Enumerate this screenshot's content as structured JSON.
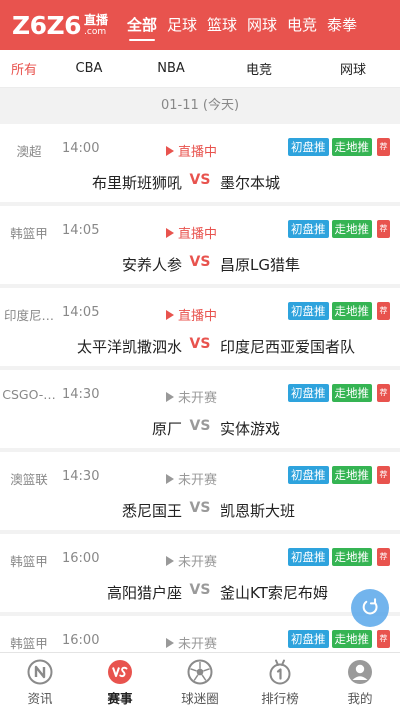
{
  "header": {
    "logo_main": "Z6Z6",
    "logo_cn": "直播",
    "logo_com": ".com",
    "tabs": [
      {
        "label": "全部"
      },
      {
        "label": "足球"
      },
      {
        "label": "篮球"
      },
      {
        "label": "网球"
      },
      {
        "label": "电竞"
      },
      {
        "label": "泰拳"
      }
    ],
    "active_tab": "全部"
  },
  "filter": {
    "items": [
      {
        "label": "所有"
      },
      {
        "label": "CBA"
      },
      {
        "label": "NBA"
      },
      {
        "label": "电竞"
      },
      {
        "label": "网球"
      }
    ],
    "active": "所有"
  },
  "date_label": "01-11 (今天)",
  "matches": [
    {
      "league": "澳超",
      "time": "14:00",
      "status": "直播中",
      "home": "布里斯班狮吼",
      "vs": "VS",
      "away": "墨尔本城"
    },
    {
      "league": "韩篮甲",
      "time": "14:05",
      "status": "直播中",
      "home": "安养人参",
      "vs": "VS",
      "away": "昌原LG猎隼"
    },
    {
      "league": "印度尼…",
      "time": "14:05",
      "status": "直播中",
      "home": "太平洋凯撒泗水",
      "vs": "VS",
      "away": "印度尼西亚爱国者队"
    },
    {
      "league": "CSGO-…",
      "time": "14:30",
      "status": "未开赛",
      "home": "原厂",
      "vs": "VS",
      "away": "实体游戏"
    },
    {
      "league": "澳篮联",
      "time": "14:30",
      "status": "未开赛",
      "home": "悉尼国王",
      "vs": "VS",
      "away": "凯恩斯大班"
    },
    {
      "league": "韩篮甲",
      "time": "16:00",
      "status": "未开赛",
      "home": "高阳猎户座",
      "vs": "VS",
      "away": "釜山KT索尼布姆"
    },
    {
      "league": "韩篮甲",
      "time": "16:00",
      "status": "未开赛",
      "home": "",
      "vs": "",
      "away": ""
    }
  ],
  "tags": {
    "blue": "初盘推",
    "green": "走地推",
    "red": "荐"
  },
  "bottom_nav": [
    {
      "label": "资讯",
      "icon": "news-icon"
    },
    {
      "label": "赛事",
      "icon": "vs-icon"
    },
    {
      "label": "球迷圈",
      "icon": "ball-icon"
    },
    {
      "label": "排行榜",
      "icon": "ranking-icon"
    },
    {
      "label": "我的",
      "icon": "user-icon"
    }
  ],
  "colors": {
    "brand": "#e8534e",
    "blue_tag": "#2ea3dd",
    "green_tag": "#35b453",
    "fab": "#5aa8ea"
  }
}
